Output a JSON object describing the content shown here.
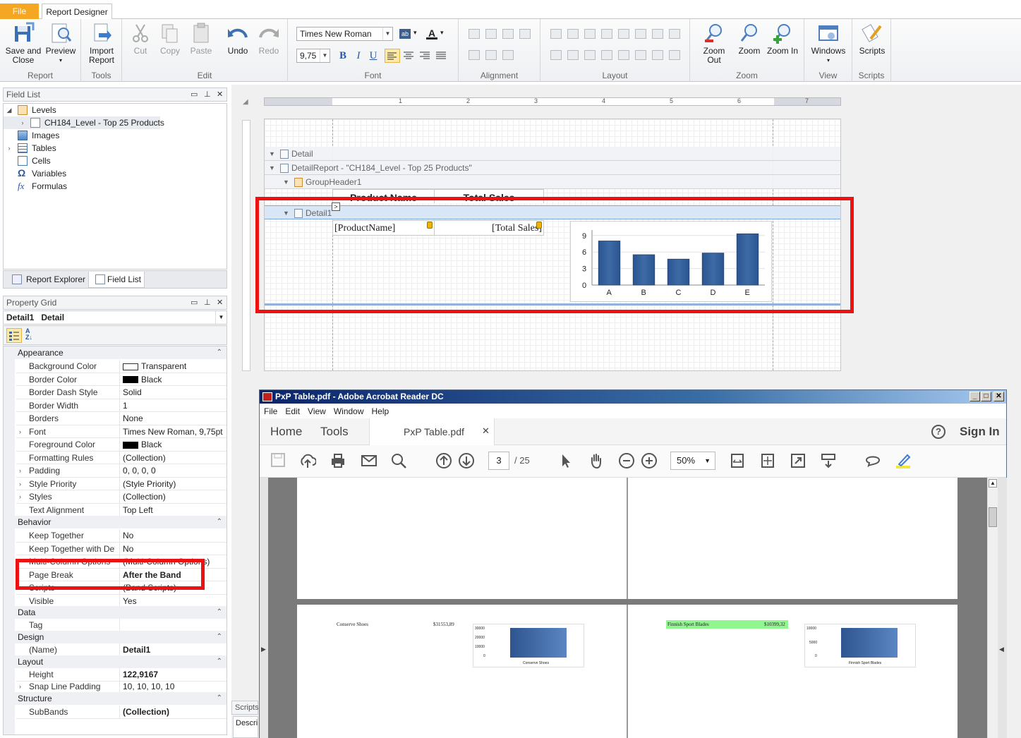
{
  "tabs": {
    "file": "File",
    "report_designer": "Report Designer"
  },
  "ribbon": {
    "groups": {
      "report": "Report",
      "tools": "Tools",
      "edit": "Edit",
      "font": "Font",
      "alignment": "Alignment",
      "layout": "Layout",
      "zoom": "Zoom",
      "view": "View",
      "scripts": "Scripts"
    },
    "save_close_1": "Save and",
    "save_close_2": "Close",
    "preview": "Preview",
    "import_1": "Import",
    "import_2": "Report",
    "cut": "Cut",
    "copy": "Copy",
    "paste": "Paste",
    "undo": "Undo",
    "redo": "Redo",
    "font_name": "Times New Roman",
    "font_size": "9,75",
    "bold": "B",
    "italic": "I",
    "underline": "U",
    "zoom_out": "Zoom Out",
    "zoom": "Zoom",
    "zoom_in": "Zoom In",
    "windows": "Windows",
    "scripts_btn": "Scripts"
  },
  "field_list": {
    "title": "Field List",
    "items": [
      {
        "label": "Levels"
      },
      {
        "label": "CH184_Level - Top 25 Products"
      },
      {
        "label": "Images"
      },
      {
        "label": "Tables"
      },
      {
        "label": "Cells"
      },
      {
        "label": "Variables"
      },
      {
        "label": "Formulas"
      }
    ],
    "tab_report_explorer": "Report Explorer",
    "tab_field_list": "Field List"
  },
  "property_grid": {
    "title": "Property Grid",
    "selected": "Detail1   Detail",
    "categories": {
      "appearance": "Appearance",
      "behavior": "Behavior",
      "data": "Data",
      "design": "Design",
      "layout": "Layout",
      "structure": "Structure"
    },
    "rows": [
      {
        "name": "Background Color",
        "value": "Transparent"
      },
      {
        "name": "Border Color",
        "value": "Black"
      },
      {
        "name": "Border Dash Style",
        "value": "Solid"
      },
      {
        "name": "Border Width",
        "value": "1"
      },
      {
        "name": "Borders",
        "value": "None"
      },
      {
        "name": "Font",
        "value": "Times New Roman, 9,75pt"
      },
      {
        "name": "Foreground Color",
        "value": "Black"
      },
      {
        "name": "Formatting Rules",
        "value": "(Collection)"
      },
      {
        "name": "Padding",
        "value": "0, 0, 0, 0"
      },
      {
        "name": "Style Priority",
        "value": "(Style Priority)"
      },
      {
        "name": "Styles",
        "value": "(Collection)"
      },
      {
        "name": "Text Alignment",
        "value": "Top Left"
      },
      {
        "name": "Keep Together",
        "value": "No"
      },
      {
        "name": "Keep Together with Detai",
        "value": "No"
      },
      {
        "name": "Multi-Column Options",
        "value": "(Multi-Column Options)"
      },
      {
        "name": "Page Break",
        "value": "After the Band"
      },
      {
        "name": "Scripts",
        "value": "(Band Scripts)"
      },
      {
        "name": "Visible",
        "value": "Yes"
      },
      {
        "name": "Tag",
        "value": ""
      },
      {
        "name": "(Name)",
        "value": "Detail1"
      },
      {
        "name": "Height",
        "value": "122,9167"
      },
      {
        "name": "Snap Line Padding",
        "value": "10, 10, 10, 10"
      },
      {
        "name": "SubBands",
        "value": "(Collection)"
      }
    ]
  },
  "designer": {
    "ruler_marks": [
      "1",
      "2",
      "3",
      "4",
      "5",
      "6",
      "7"
    ],
    "bands": {
      "detail": "Detail",
      "detail_report": "DetailReport - \"CH184_Level - Top 25 Products\"",
      "group_header": "GroupHeader1",
      "detail1": "Detail1"
    },
    "header_cells": [
      "Product Name",
      "Total Sales"
    ],
    "cells": [
      "[ProductName]",
      "[Total Sales]"
    ],
    "scripts_tab": "Scripts",
    "descr_tab": "Descri"
  },
  "chart_data": {
    "type": "bar",
    "categories": [
      "A",
      "B",
      "C",
      "D",
      "E"
    ],
    "values": [
      8,
      5.5,
      4.7,
      5.8,
      9.3
    ],
    "ylim": [
      0,
      10
    ],
    "yticks": [
      "0",
      "3",
      "6",
      "9"
    ],
    "color": "#3d6aa5"
  },
  "acrobat": {
    "title": "PxP Table.pdf - Adobe Acrobat Reader DC",
    "menu": [
      "File",
      "Edit",
      "View",
      "Window",
      "Help"
    ],
    "nav_home": "Home",
    "nav_tools": "Tools",
    "doc_tab": "PxP Table.pdf",
    "help": "?",
    "sign_in": "Sign In",
    "page_current": "3",
    "page_total": "/ 25",
    "zoom": "50%",
    "left_page": {
      "product": "Conserve Shoes",
      "amount": "$31553,89",
      "yticks": [
        "30000",
        "20000",
        "10000",
        "0"
      ],
      "xlabel": "Conserve Shoes"
    },
    "right_page": {
      "product": "Finnish Sport Blades",
      "amount": "$10399,32",
      "yticks": [
        "10000",
        "5000",
        "0"
      ],
      "xlabel": "Finnish Sport Blades"
    }
  }
}
